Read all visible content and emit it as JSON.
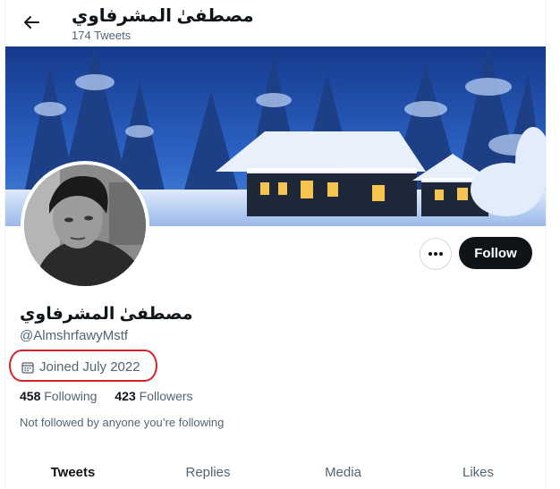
{
  "header": {
    "title": "مصطفىٰ المشرفاوي",
    "tweet_count": "174 Tweets"
  },
  "profile": {
    "display_name": "مصطفىٰ المشرفاوي",
    "handle": "@AlmshrfawyMstf",
    "joined": "Joined July 2022",
    "following_count": "458",
    "following_label": "Following",
    "followers_count": "423",
    "followers_label": "Followers",
    "not_followed": "Not followed by anyone you’re following"
  },
  "actions": {
    "follow_label": "Follow",
    "more_icon": "more-horizontal-icon"
  },
  "tabs": [
    {
      "label": "Tweets",
      "active": true
    },
    {
      "label": "Replies",
      "active": false
    },
    {
      "label": "Media",
      "active": false
    },
    {
      "label": "Likes",
      "active": false
    }
  ],
  "colors": {
    "follow_bg": "#0f1419",
    "highlight": "#d2232a",
    "muted_text": "#536471"
  }
}
